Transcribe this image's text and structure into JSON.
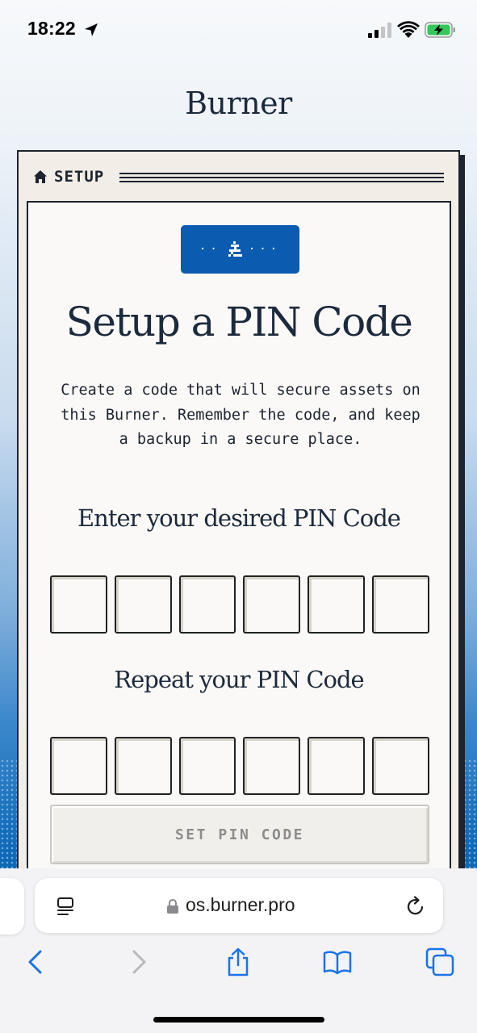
{
  "status_bar": {
    "time": "18:22"
  },
  "app": {
    "title": "Burner"
  },
  "window": {
    "title": "SETUP"
  },
  "setup": {
    "badge_left": "··",
    "badge_right": "···",
    "heading": "Setup a PIN Code",
    "description": "Create a code that will secure assets on this Burner. Remember the code, and keep a backup in a secure place.",
    "enter_label": "Enter your desired PIN Code",
    "repeat_label": "Repeat your PIN Code",
    "pin_length": 6,
    "submit_label": "SET PIN CODE"
  },
  "browser": {
    "url": "os.burner.pro"
  },
  "colors": {
    "accent": "#0b5bb0",
    "ink": "#1c2a3d",
    "disabled_text": "#8c8c8c"
  }
}
